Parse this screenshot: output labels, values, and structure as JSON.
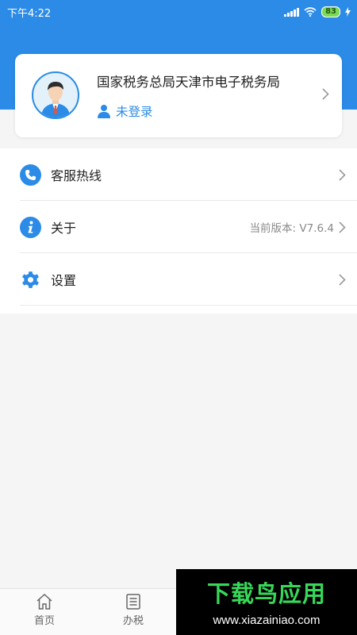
{
  "status_bar": {
    "time": "下午4:22",
    "battery": "83"
  },
  "profile": {
    "org_name": "国家税务总局天津市电子税务局",
    "login_status": "未登录"
  },
  "menu": [
    {
      "label": "客服热线",
      "detail": "",
      "icon": "phone-icon"
    },
    {
      "label": "关于",
      "detail": "当前版本: V7.6.4",
      "icon": "info-icon"
    },
    {
      "label": "设置",
      "detail": "",
      "icon": "gear-icon"
    }
  ],
  "tabs": [
    {
      "label": "首页",
      "icon": "home-icon"
    },
    {
      "label": "办税",
      "icon": "document-icon"
    }
  ],
  "watermark": {
    "title": "下载鸟应用",
    "url": "www.xiazainiao.com"
  },
  "colors": {
    "accent": "#2b8be6",
    "background": "#f5f5f5",
    "watermark_green": "#37d85a"
  }
}
